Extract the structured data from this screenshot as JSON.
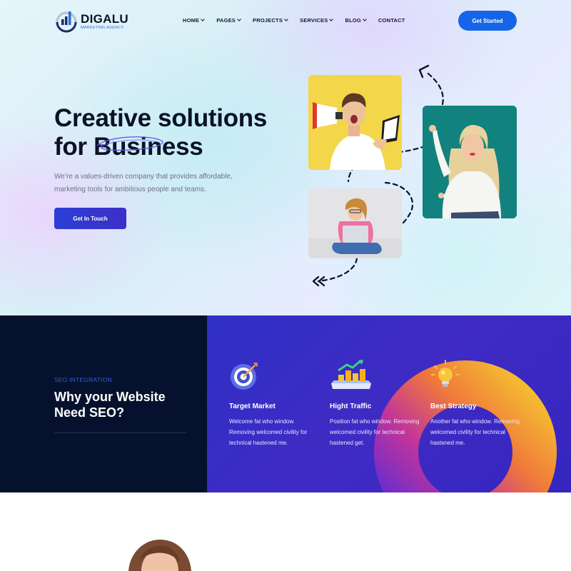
{
  "brand": {
    "name": "DIGALU",
    "tagline": "MARKETING AGENCY",
    "accent": "#1565e8",
    "dark": "#06122d",
    "purple": "#3a2cc6"
  },
  "nav": {
    "items": [
      {
        "label": "HOME",
        "has_dropdown": true
      },
      {
        "label": "PAGES",
        "has_dropdown": true
      },
      {
        "label": "PROJECTS",
        "has_dropdown": true
      },
      {
        "label": "SERVICES",
        "has_dropdown": true
      },
      {
        "label": "BLOG",
        "has_dropdown": true
      },
      {
        "label": "CONTACT",
        "has_dropdown": false
      }
    ],
    "cta_label": "Get Started"
  },
  "hero": {
    "title_line1": "Creative solutions",
    "title_line2": "for Business",
    "description": "We’re a values-driven company that provides affordable, marketing tools for ambitious people and teams.",
    "button_label": "Get In Touch",
    "photos": [
      "man-with-megaphone-photo",
      "woman-pointing-photo",
      "woman-with-laptop-photo"
    ]
  },
  "seo": {
    "kicker": "SEO INTEGRATION",
    "title": "Why your Website Need SEO?",
    "features": [
      {
        "icon": "target-icon",
        "title": "Target Market",
        "description": "Welcome fat who window. Removing welcomed civility for technical hastened me."
      },
      {
        "icon": "traffic-chart-icon",
        "title": "Hight Traffic",
        "description": "Position fat who window. Removing welcomed civility for technical hastened get."
      },
      {
        "icon": "lightbulb-icon",
        "title": "Best Strategy",
        "description": "Another fat who window. Removing welcomed civility for technical hastened me."
      }
    ]
  }
}
